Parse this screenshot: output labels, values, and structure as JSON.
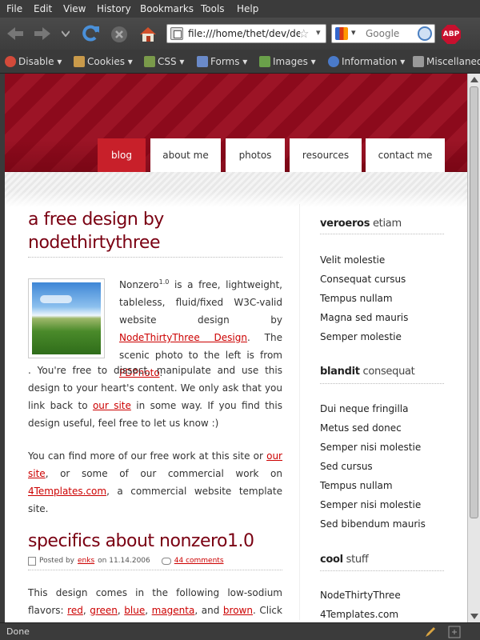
{
  "menubar": [
    {
      "label": "File"
    },
    {
      "label": "Edit"
    },
    {
      "label": "View"
    },
    {
      "label": "History"
    },
    {
      "label": "Bookmarks"
    },
    {
      "label": "Tools"
    },
    {
      "label": "Help"
    }
  ],
  "navbar": {
    "url": "file:///home/thet/dev/de",
    "search_placeholder": "Google",
    "adblock_label": "ABP"
  },
  "devbar": [
    {
      "label": "Disable ▾",
      "color": "#d34a3a"
    },
    {
      "label": "Cookies ▾",
      "color": "#c99a4a"
    },
    {
      "label": "CSS ▾",
      "color": "#7a9a4a"
    },
    {
      "label": "Forms ▾",
      "color": "#6a8ac9"
    },
    {
      "label": "Images ▾",
      "color": "#6aa04a"
    },
    {
      "label": "Information ▾",
      "color": "#4a7ac9"
    },
    {
      "label": "Miscellaneo",
      "color": "#999999"
    }
  ],
  "site": {
    "tabs": [
      {
        "label": "blog",
        "active": true
      },
      {
        "label": "about me",
        "active": false
      },
      {
        "label": "photos",
        "active": false
      },
      {
        "label": "resources",
        "active": false
      },
      {
        "label": "contact me",
        "active": false
      }
    ],
    "post1": {
      "title": "a free design by nodethirtythree",
      "p1_a": "Nonzero",
      "p1_sup": "1.0",
      "p1_b": " is a free, lightweight, tableless, fluid/fixed W3C-valid website design by ",
      "link_ntt": "NodeThirtyThree Design",
      "p1_c": ". The scenic photo to the left is from ",
      "link_pd": "PDPhoto",
      "p1_d": ". You're free to dissect, manipulate and use this design to your heart's content. We only ask that you link back to ",
      "link_site": "our site",
      "p1_e": " in some way. If you find this design useful, feel free to let us know :)",
      "p2_a": "You can find more of our free work at this site or ",
      "link_site2": "our site",
      "p2_b": ", or some of our commercial work on ",
      "link_4t": "4Templates.com",
      "p2_c": ", a commercial website template site."
    },
    "post2": {
      "title": "specifics about nonzero1.0",
      "meta_posted": "Posted by",
      "meta_author": "enks",
      "meta_on": "on 11.14.2006",
      "meta_comments": "44 comments",
      "p_a": "This design comes in the following low-sodium flavors: ",
      "c_red": "red",
      "c_green": "green",
      "c_blue": "blue",
      "c_magenta": "magenta",
      "sep": ", ",
      "and": ", and ",
      "c_brown": "brown",
      "p_b": ". Click on a color"
    },
    "sidebar": [
      {
        "bold": "veroeros",
        "rest": " etiam",
        "links": [
          "Velit molestie",
          "Consequat cursus",
          "Tempus nullam",
          "Magna sed mauris",
          "Semper molestie"
        ]
      },
      {
        "bold": "blandit",
        "rest": " consequat",
        "links": [
          "Dui neque fringilla",
          "Metus sed donec",
          "Semper nisi molestie",
          "Sed cursus",
          "Tempus nullam",
          "Semper nisi molestie",
          "Sed bibendum mauris"
        ]
      },
      {
        "bold": "cool",
        "rest": " stuff",
        "links": [
          "NodeThirtyThree",
          "4Templates.com"
        ]
      }
    ]
  },
  "status": {
    "text": "Done"
  }
}
